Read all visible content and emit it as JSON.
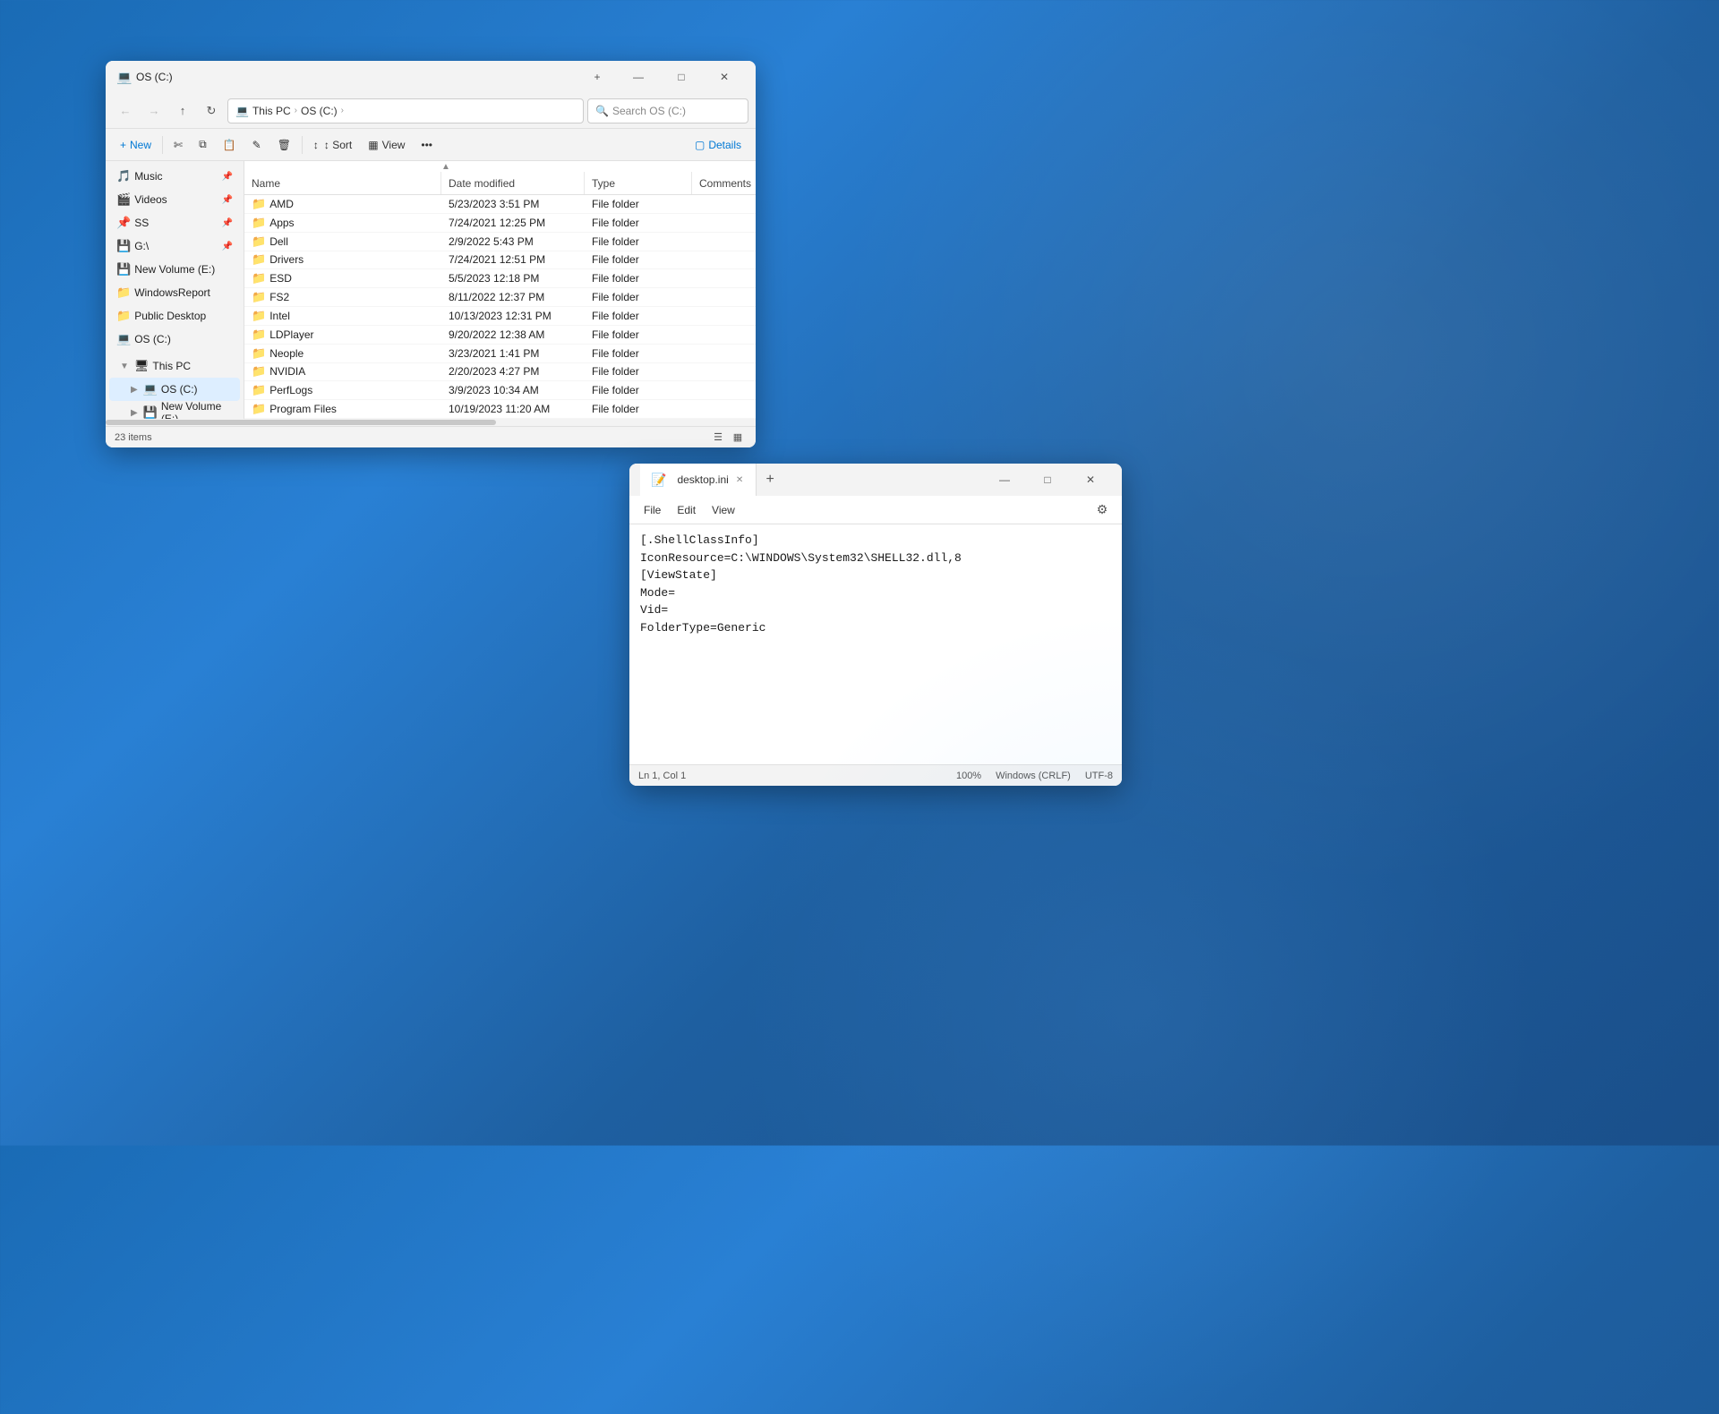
{
  "desktop": {
    "background": "blue-gradient"
  },
  "file_explorer": {
    "title": "OS (C:)",
    "window_icon": "💻",
    "titlebar": {
      "minimize": "—",
      "maximize": "□",
      "close": "✕",
      "new_tab": "+"
    },
    "address_bar": {
      "back": "←",
      "forward": "→",
      "up": "↑",
      "refresh": "⟳",
      "breadcrumb": [
        "This PC",
        "OS (C:)"
      ],
      "search_placeholder": "Search OS (C:)",
      "search_icon": "🔍"
    },
    "toolbar": {
      "new_label": "+ New",
      "cut_icon": "✂",
      "copy_icon": "⎘",
      "paste_icon": "📋",
      "rename_icon": "✏",
      "delete_icon": "🗑",
      "sort_label": "↕ Sort",
      "view_label": "⊞ View",
      "more_icon": "•••",
      "details_label": "Details"
    },
    "sidebar": {
      "items": [
        {
          "label": "Music",
          "icon": "🎵",
          "pinned": true
        },
        {
          "label": "Videos",
          "icon": "🎬",
          "pinned": true
        },
        {
          "label": "SS",
          "icon": "📌",
          "pinned": true
        },
        {
          "label": "G:\\",
          "icon": "💾",
          "pinned": true
        },
        {
          "label": "New Volume (E:)",
          "icon": "💾",
          "pinned": false
        },
        {
          "label": "WindowsReport",
          "icon": "📁",
          "pinned": false
        },
        {
          "label": "Public Desktop",
          "icon": "📁",
          "pinned": false
        },
        {
          "label": "OS (C:)",
          "icon": "💻",
          "pinned": false
        }
      ],
      "this_pc": {
        "label": "This PC",
        "expanded": true,
        "icon": "🖥"
      },
      "drives": [
        {
          "label": "OS (C:)",
          "icon": "💻",
          "active": true
        },
        {
          "label": "New Volume (E:)",
          "icon": "💾",
          "active": false
        }
      ]
    },
    "columns": [
      "Name",
      "Date modified",
      "Type",
      "Comments"
    ],
    "files": [
      {
        "name": "AMD",
        "date": "5/23/2023 3:51 PM",
        "type": "File folder",
        "comments": ""
      },
      {
        "name": "Apps",
        "date": "7/24/2021 12:25 PM",
        "type": "File folder",
        "comments": ""
      },
      {
        "name": "Dell",
        "date": "2/9/2022 5:43 PM",
        "type": "File folder",
        "comments": ""
      },
      {
        "name": "Drivers",
        "date": "7/24/2021 12:51 PM",
        "type": "File folder",
        "comments": ""
      },
      {
        "name": "ESD",
        "date": "5/5/2023 12:18 PM",
        "type": "File folder",
        "comments": ""
      },
      {
        "name": "FS2",
        "date": "8/11/2022 12:37 PM",
        "type": "File folder",
        "comments": ""
      },
      {
        "name": "Intel",
        "date": "10/13/2023 12:31 PM",
        "type": "File folder",
        "comments": ""
      },
      {
        "name": "LDPlayer",
        "date": "9/20/2022 12:38 AM",
        "type": "File folder",
        "comments": ""
      },
      {
        "name": "Neople",
        "date": "3/23/2021 1:41 PM",
        "type": "File folder",
        "comments": ""
      },
      {
        "name": "NVIDIA",
        "date": "2/20/2023 4:27 PM",
        "type": "File folder",
        "comments": ""
      },
      {
        "name": "PerfLogs",
        "date": "3/9/2023 10:34 AM",
        "type": "File folder",
        "comments": ""
      },
      {
        "name": "Program Files",
        "date": "10/19/2023 11:20 AM",
        "type": "File folder",
        "comments": ""
      }
    ],
    "status": {
      "count": "23 items",
      "view_list": "≡",
      "view_grid": "⊞"
    }
  },
  "notepad": {
    "window_icon": "📝",
    "title": "desktop.ini",
    "titlebar": {
      "minimize": "—",
      "maximize": "□",
      "close": "✕",
      "new_tab": "+"
    },
    "tab": {
      "label": "desktop.ini",
      "close": "✕"
    },
    "menu": {
      "file": "File",
      "edit": "Edit",
      "view": "View",
      "settings_icon": "⚙"
    },
    "content": "[.ShellClassInfo]\nIconResource=C:\\WINDOWS\\System32\\SHELL32.dll,8\n[ViewState]\nMode=\nVid=\nFolderType=Generic",
    "status": {
      "position": "Ln 1, Col 1",
      "zoom": "100%",
      "line_ending": "Windows (CRLF)",
      "encoding": "UTF-8"
    }
  }
}
